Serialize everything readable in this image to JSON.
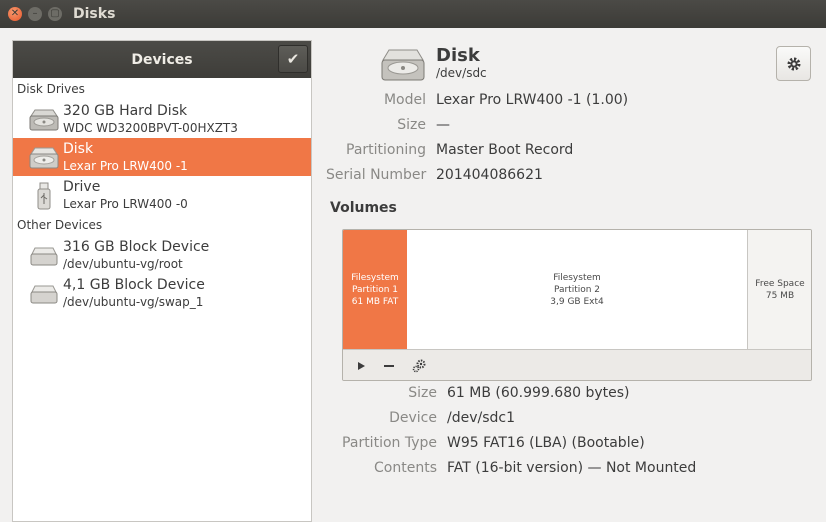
{
  "window": {
    "title": "Disks"
  },
  "devices_panel": {
    "title": "Devices",
    "groups": [
      {
        "label": "Disk Drives",
        "items": [
          {
            "name": "320 GB Hard Disk",
            "sub": "WDC WD3200BPVT-00HXZT3",
            "icon": "hard-disk-icon"
          },
          {
            "name": "Disk",
            "sub": "Lexar Pro LRW400    -1",
            "icon": "hard-disk-icon",
            "selected": true
          },
          {
            "name": "Drive",
            "sub": "Lexar Pro LRW400    -0",
            "icon": "usb-drive-icon"
          }
        ]
      },
      {
        "label": "Other Devices",
        "items": [
          {
            "name": "316 GB Block Device",
            "sub": "/dev/ubuntu-vg/root",
            "icon": "block-device-icon"
          },
          {
            "name": "4,1 GB Block Device",
            "sub": "/dev/ubuntu-vg/swap_1",
            "icon": "block-device-icon"
          }
        ]
      }
    ]
  },
  "drive": {
    "title": "Disk",
    "path": "/dev/sdc",
    "fields": {
      "model_label": "Model",
      "model_value": "Lexar Pro LRW400    -1 (1.00)",
      "size_label": "Size",
      "size_value": "—",
      "partitioning_label": "Partitioning",
      "partitioning_value": "Master Boot Record",
      "serial_label": "Serial Number",
      "serial_value": "201404086621"
    }
  },
  "volumes": {
    "title": "Volumes",
    "segments": {
      "p1_l1": "Filesystem",
      "p1_l2": "Partition 1",
      "p1_l3": "61 MB FAT",
      "p2_l1": "Filesystem",
      "p2_l2": "Partition 2",
      "p2_l3": "3,9 GB Ext4",
      "free_l1": "Free Space",
      "free_l2": "75 MB"
    },
    "details": {
      "size_label": "Size",
      "size_value": "61 MB (60.999.680 bytes)",
      "device_label": "Device",
      "device_value": "/dev/sdc1",
      "ptype_label": "Partition Type",
      "ptype_value": "W95 FAT16 (LBA) (Bootable)",
      "contents_label": "Contents",
      "contents_value": "FAT (16-bit version) — Not Mounted"
    }
  },
  "colors": {
    "accent": "#f07746",
    "titlebar": "#3c3b37",
    "panel_header": "#4c4b47"
  }
}
